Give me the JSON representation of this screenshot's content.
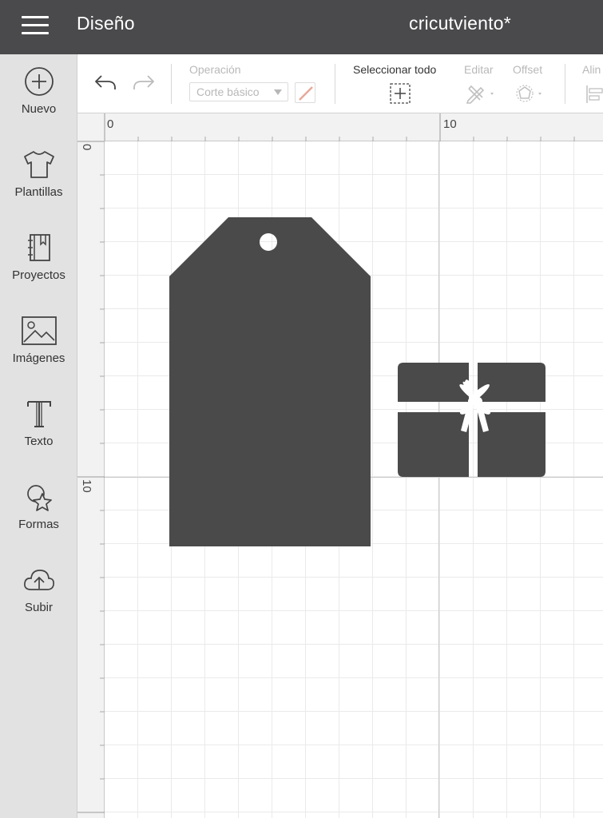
{
  "header": {
    "title": "Diseño",
    "project_name": "cricutviento*"
  },
  "sidebar": {
    "items": [
      {
        "label": "Nuevo",
        "icon": "plus-circle-icon"
      },
      {
        "label": "Plantillas",
        "icon": "tshirt-icon"
      },
      {
        "label": "Proyectos",
        "icon": "notebook-icon"
      },
      {
        "label": "Imágenes",
        "icon": "image-icon"
      },
      {
        "label": "Texto",
        "icon": "text-t-icon"
      },
      {
        "label": "Formas",
        "icon": "shapes-icon"
      },
      {
        "label": "Subir",
        "icon": "cloud-upload-icon"
      }
    ]
  },
  "toolbar": {
    "undo_icon": "undo-icon",
    "redo_icon": "redo-icon",
    "operation_label": "Operación",
    "operation_value": "Corte básico",
    "select_all_label": "Seleccionar todo",
    "edit_label": "Editar",
    "offset_label": "Offset",
    "align_label": "Alin"
  },
  "ruler": {
    "h_labels": [
      "0",
      "10"
    ],
    "v_labels": [
      "0",
      "10"
    ]
  },
  "canvas": {
    "shape_color": "#4a4a4a",
    "shapes": [
      {
        "name": "gift-tag"
      },
      {
        "name": "gift-box"
      }
    ]
  }
}
